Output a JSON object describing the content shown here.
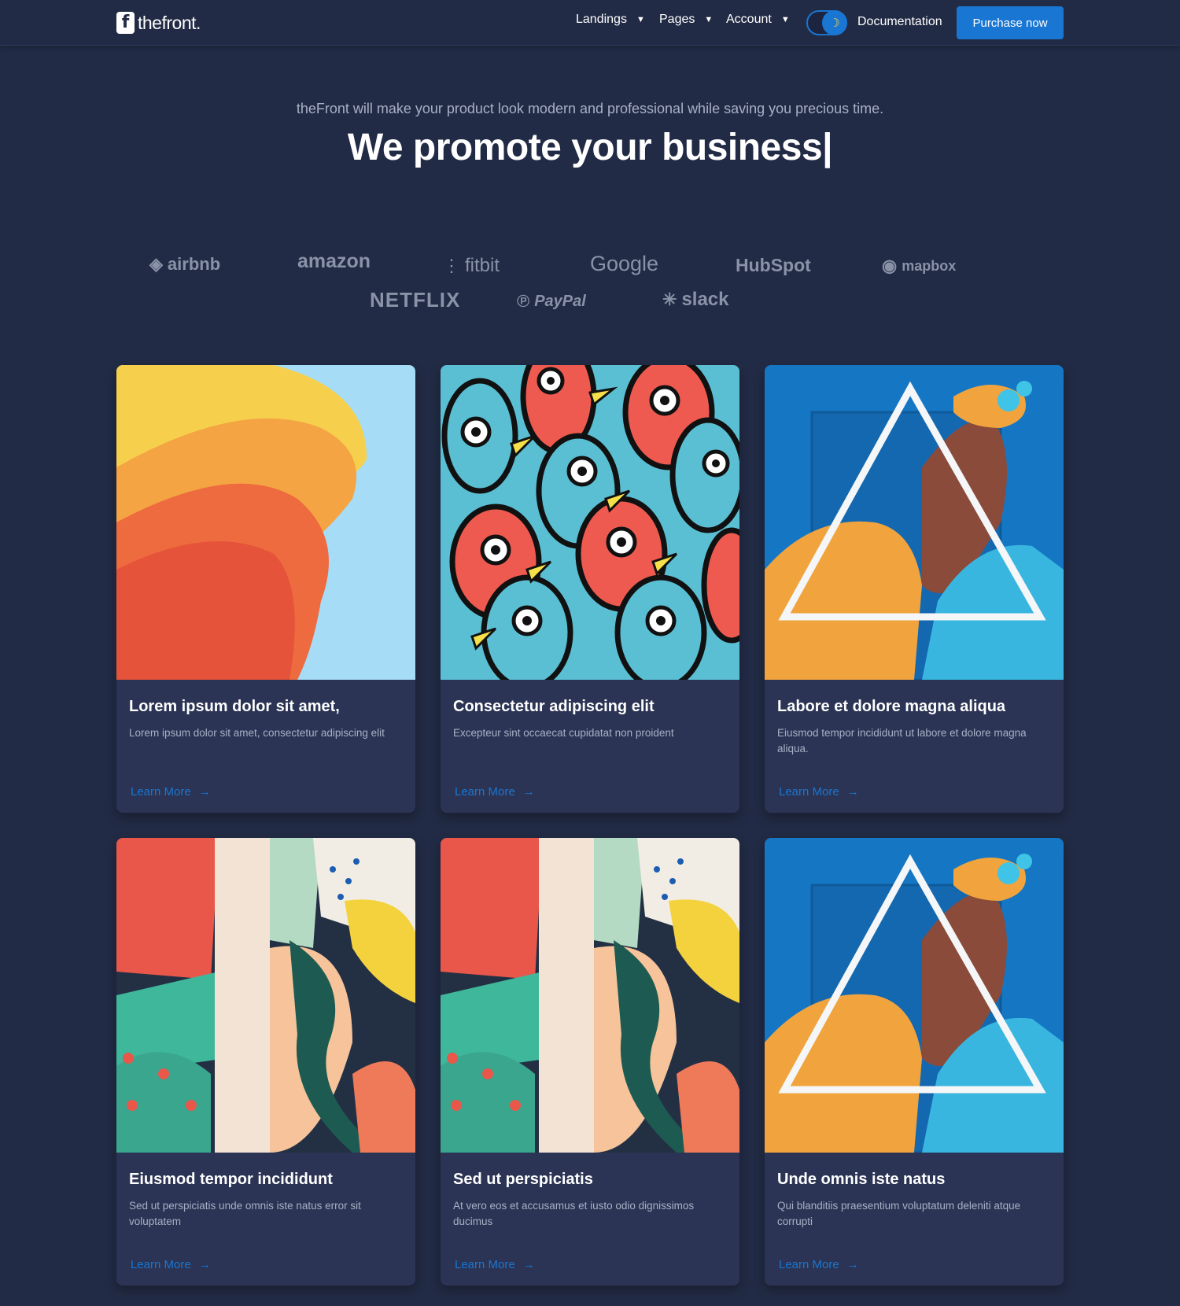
{
  "header": {
    "logo_mark": "f",
    "logo_text": "thefront.",
    "nav": [
      {
        "label": "Landings"
      },
      {
        "label": "Pages"
      },
      {
        "label": "Account"
      }
    ],
    "documentation_label": "Documentation",
    "purchase_label": "Purchase now",
    "theme_toggle_icon": "moon-icon"
  },
  "hero": {
    "subtitle": "theFront will make your product look modern and professional while saving you precious time.",
    "title": "We promote your business|"
  },
  "brands": [
    "airbnb",
    "amazon",
    "fitbit",
    "Google",
    "HubSpot",
    "mapbox",
    "NETFLIX",
    "PayPal",
    "slack"
  ],
  "cards": [
    {
      "title": "Lorem ipsum dolor sit amet,",
      "text": "Lorem ipsum dolor sit amet, consectetur adipiscing elit",
      "link": "Learn More"
    },
    {
      "title": "Consectetur adipiscing elit",
      "text": "Excepteur sint occaecat cupidatat non proident",
      "link": "Learn More"
    },
    {
      "title": "Labore et dolore magna aliqua",
      "text": "Eiusmod tempor incididunt ut labore et dolore magna aliqua.",
      "link": "Learn More"
    },
    {
      "title": "Eiusmod tempor incididunt",
      "text": "Sed ut perspiciatis unde omnis iste natus error sit voluptatem",
      "link": "Learn More"
    },
    {
      "title": "Sed ut perspiciatis",
      "text": "At vero eos et accusamus et iusto odio dignissimos ducimus",
      "link": "Learn More"
    },
    {
      "title": "Unde omnis iste natus",
      "text": "Qui blanditiis praesentium voluptatum deleniti atque corrupti",
      "link": "Learn More"
    }
  ],
  "colors": {
    "background": "#222b45",
    "card": "#2b3454",
    "accent": "#1976d2",
    "muted_text": "#a8b0c6"
  }
}
